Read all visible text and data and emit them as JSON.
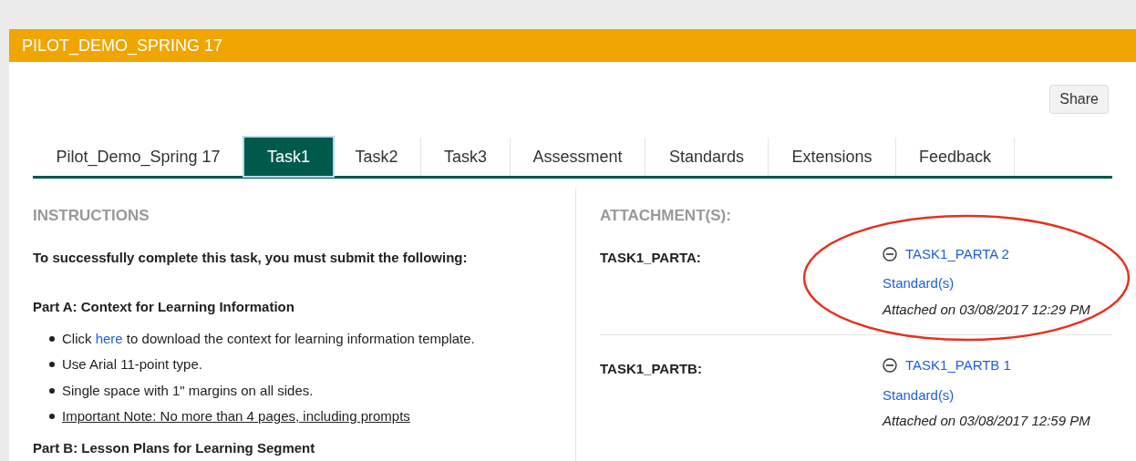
{
  "header": {
    "title": "PILOT_DEMO_SPRING 17"
  },
  "share_button": "Share",
  "tabs": [
    {
      "label": "Pilot_Demo_Spring 17",
      "selected": false
    },
    {
      "label": "Task1",
      "selected": true
    },
    {
      "label": "Task2",
      "selected": false
    },
    {
      "label": "Task3",
      "selected": false
    },
    {
      "label": "Assessment",
      "selected": false
    },
    {
      "label": "Standards",
      "selected": false
    },
    {
      "label": "Extensions",
      "selected": false
    },
    {
      "label": "Feedback",
      "selected": false
    }
  ],
  "instructions": {
    "heading": "INSTRUCTIONS",
    "intro": "To successfully complete this task, you must submit the following:",
    "parts": [
      {
        "title": "Part A: Context for Learning Information",
        "bullets": [
          {
            "before": "Click ",
            "link": "here",
            "after": " to download the context for learning information template.",
            "underlined": false
          },
          {
            "before": "Use Arial 11-point type.",
            "underlined": false
          },
          {
            "before": "Single space with 1\" margins on all sides.",
            "underlined": false
          },
          {
            "before": "Important Note: No more than 4 pages, including prompts",
            "underlined": true
          }
        ]
      },
      {
        "title": "Part B: Lesson Plans for Learning Segment"
      }
    ]
  },
  "attachments": {
    "heading": "ATTACHMENT(S):",
    "rows": [
      {
        "label": "TASK1_PARTA:",
        "file": "TASK1_PARTA 2",
        "standards": "Standard(s)",
        "attached": "Attached on 03/08/2017 12:29 PM",
        "circled": true
      },
      {
        "label": "TASK1_PARTB:",
        "file": "TASK1_PARTB 1",
        "standards": "Standard(s)",
        "attached": "Attached on 03/08/2017 12:59 PM",
        "circled": false
      }
    ]
  }
}
